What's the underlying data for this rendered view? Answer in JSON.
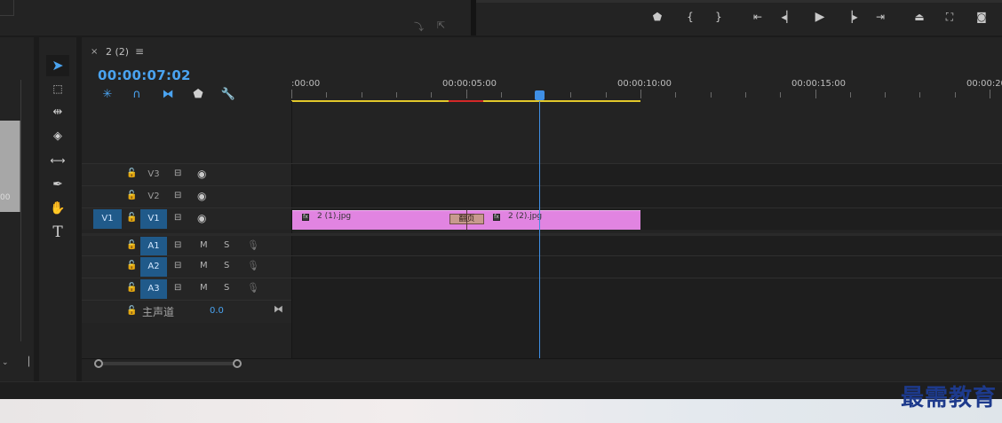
{
  "sequence": {
    "name": "2 (2)",
    "close_glyph": "×",
    "menu_glyph": "≡",
    "timecode": "00:00:07:02"
  },
  "source": {
    "time_fragment": "00"
  },
  "ruler": {
    "labels": [
      ":00:00",
      "00:00:05:00",
      "00:00:10:00",
      "00:00:15:00",
      "00:00:20"
    ]
  },
  "tracks": {
    "video": [
      {
        "name": "V3",
        "active": false
      },
      {
        "name": "V2",
        "active": false
      },
      {
        "name": "V1",
        "active": true,
        "target": "V1"
      }
    ],
    "audio": [
      {
        "name": "A1",
        "m": "M",
        "s": "S"
      },
      {
        "name": "A2",
        "m": "M",
        "s": "S"
      },
      {
        "name": "A3",
        "m": "M",
        "s": "S"
      }
    ],
    "master": {
      "name": "主声道",
      "value": "0.0"
    }
  },
  "clips": {
    "clip1_label": "2 (1).jpg",
    "clip2_label": "2 (2).jpg",
    "transition_label": "翻页",
    "clip_color": "#e184e1"
  },
  "colors": {
    "accent": "#4aa3f0",
    "playhead": "#3f8fe5",
    "work_area": "#e2c82b",
    "render_red": "#d42828",
    "track_active": "#205a8a"
  },
  "watermark": "最需教育"
}
